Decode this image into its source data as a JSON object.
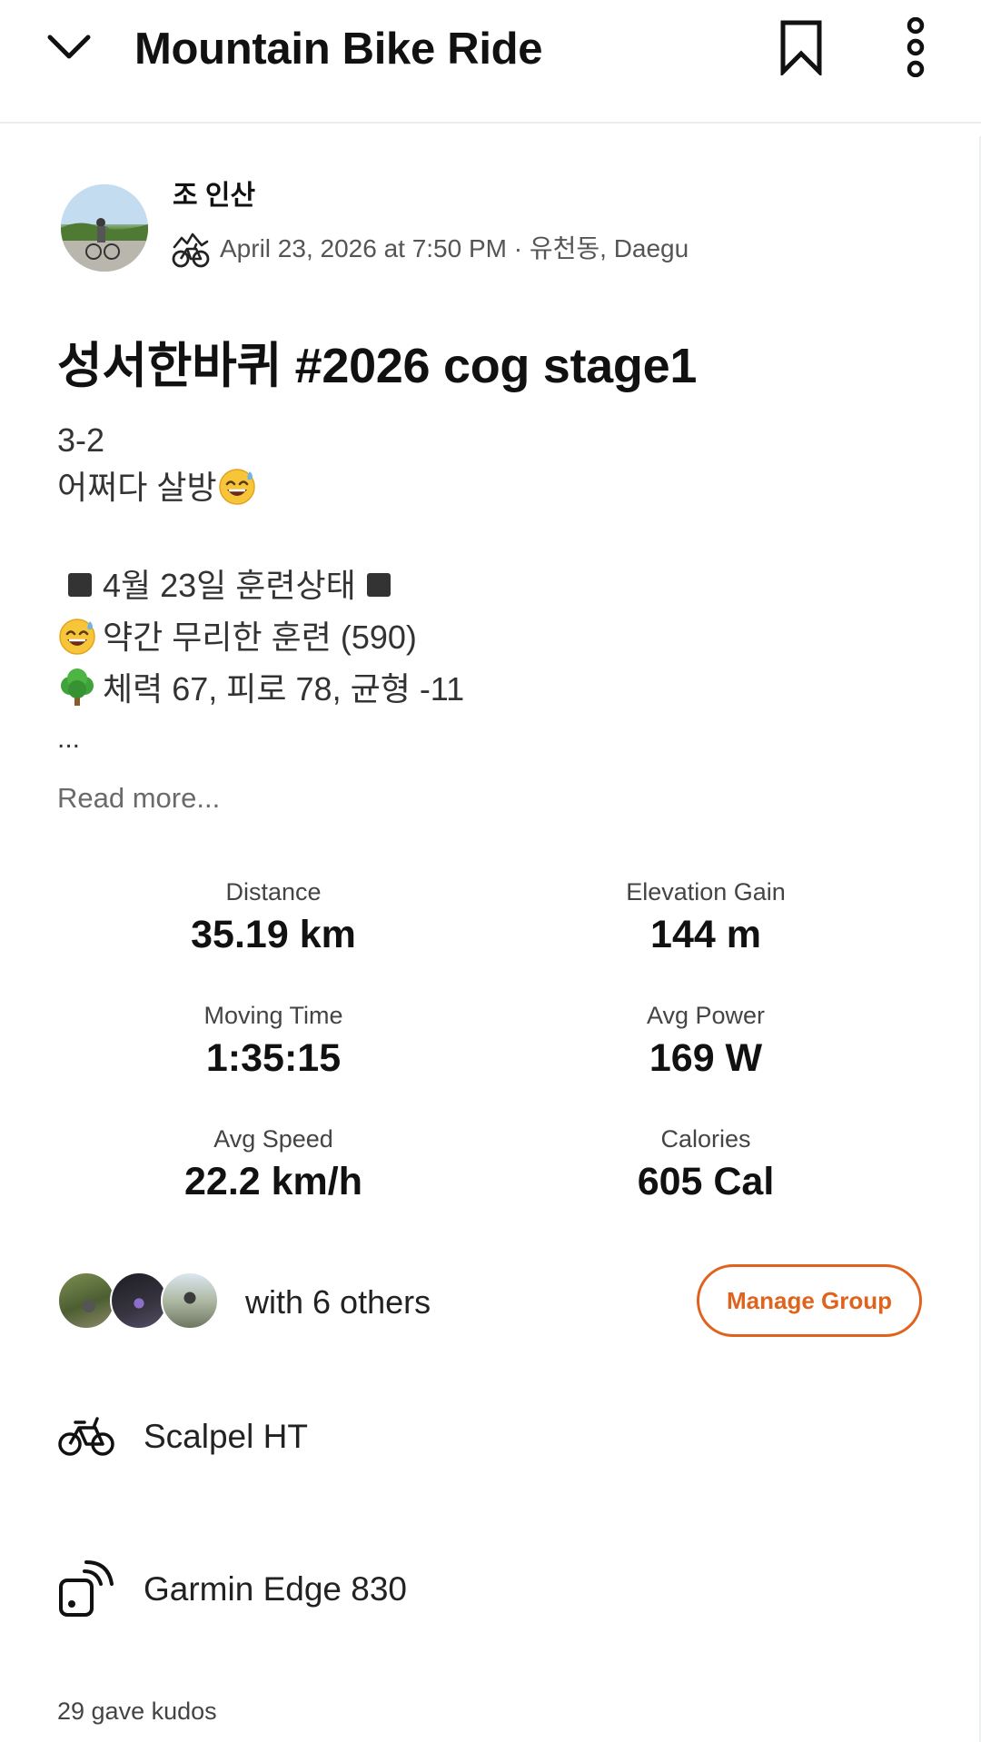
{
  "header": {
    "title": "Mountain Bike Ride",
    "back_icon": "chevron-down-icon",
    "bookmark_icon": "bookmark-icon",
    "more_icon": "more-vertical-icon"
  },
  "athlete": {
    "name": "조 인산",
    "activity_type_icon": "mountain-bike-icon",
    "meta": "April 23, 2026 at 7:50 PM · 유천동, Daegu"
  },
  "activity": {
    "title": "성서한바퀴 #2026 cog stage1",
    "description": {
      "line1": "3-2",
      "line2": "어쩌다 살방",
      "line3": "4월 23일 훈련상태",
      "line4": "약간 무리한 훈련 (590)",
      "line5": "체력 67, 피로 78, 균형 -11",
      "ellipsis": "...",
      "read_more": "Read more..."
    }
  },
  "stats": {
    "distance": {
      "label": "Distance",
      "value": "35.19 km"
    },
    "elevation": {
      "label": "Elevation Gain",
      "value": "144 m"
    },
    "moving_time": {
      "label": "Moving Time",
      "value": "1:35:15"
    },
    "avg_power": {
      "label": "Avg Power",
      "value": "169 W"
    },
    "avg_speed": {
      "label": "Avg Speed",
      "value": "22.2 km/h"
    },
    "calories": {
      "label": "Calories",
      "value": "605 Cal"
    }
  },
  "group": {
    "text": "with 6 others",
    "manage_label": "Manage Group"
  },
  "gear": {
    "bike": "Scalpel HT",
    "device": "Garmin Edge 830"
  },
  "kudos": {
    "text": "29 gave kudos"
  },
  "colors": {
    "accent": "#e0631d",
    "text": "#111111",
    "muted": "#6a6a6a"
  }
}
